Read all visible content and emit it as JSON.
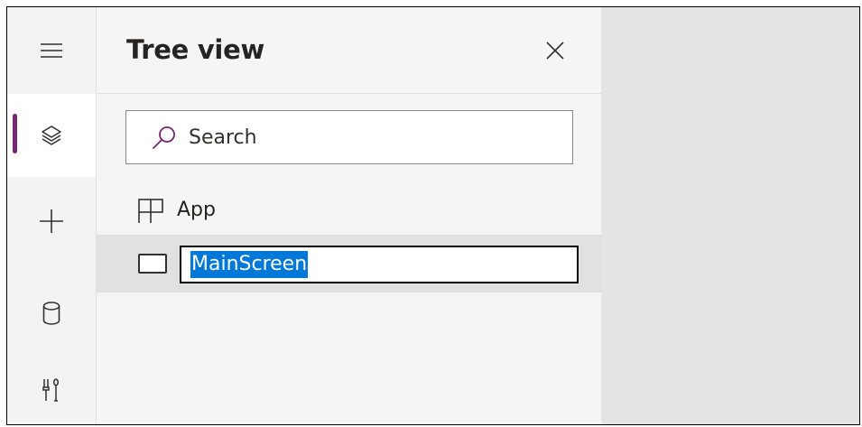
{
  "panel": {
    "title": "Tree view",
    "close_label": "Close"
  },
  "search": {
    "placeholder": "Search",
    "value": ""
  },
  "tree": {
    "app_label": "App",
    "screen_name": "MainScreen"
  },
  "rail": {
    "items": [
      {
        "icon": "hamburger-menu-icon",
        "active": false
      },
      {
        "icon": "layers-icon",
        "active": true
      },
      {
        "icon": "plus-icon",
        "active": false
      },
      {
        "icon": "database-icon",
        "active": false
      },
      {
        "icon": "tools-icon",
        "active": false
      }
    ]
  },
  "colors": {
    "accent": "#742774",
    "selection": "#0078d7",
    "canvas": "#e4e4e4",
    "panel": "#f5f5f5"
  }
}
